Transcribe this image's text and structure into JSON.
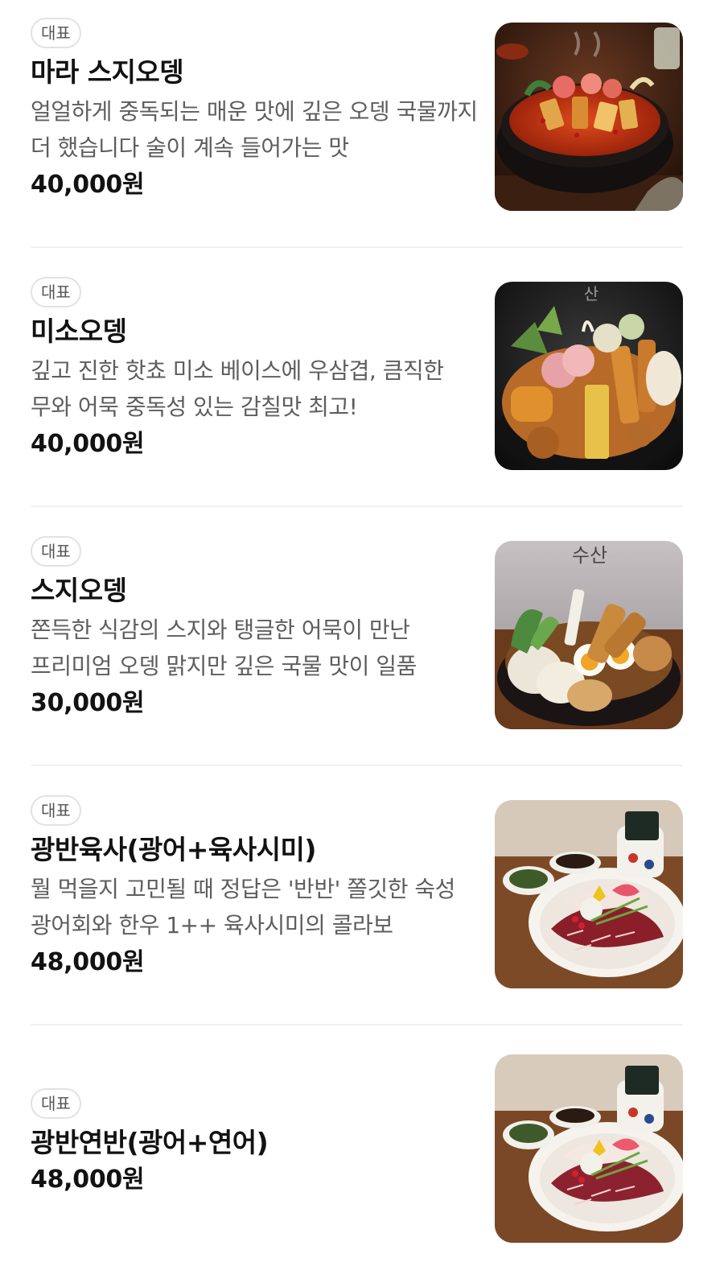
{
  "items": [
    {
      "badge": "대표",
      "name": "마라 스지오뎅",
      "description": "얼얼하게 중독되는 매운 맛에 깊은 오뎅 국물까지 더 했습니다 술이 계속 들어가는 맛",
      "price": "40,000원",
      "image": "mala-oden-hotpot-photo"
    },
    {
      "badge": "대표",
      "name": "미소오뎅",
      "description": "깊고 진한 핫쵸 미소 베이스에 우삼겹, 큼직한 무와 어묵 중독성 있는 감칠맛 최고!",
      "price": "40,000원",
      "image": "miso-oden-hotpot-photo",
      "image_text": "산"
    },
    {
      "badge": "대표",
      "name": "스지오뎅",
      "description": "쫀득한 식감의 스지와 탱글한 어묵이 만난 프리미엄 오뎅 맑지만 깊은 국물 맛이 일품",
      "price": "30,000원",
      "image": "suji-oden-hotpot-photo",
      "image_text": "수산"
    },
    {
      "badge": "대표",
      "name": "광반육사(광어+육사시미)",
      "description": "뭘 먹을지 고민될 때 정답은 '반반' 쫄깃한 숙성 광어회와 한우 1++ 육사시미의 콜라보",
      "price": "48,000원",
      "image": "flatfish-and-beef-sashimi-platter-photo"
    },
    {
      "badge": "대표",
      "name": "광반연반(광어+연어)",
      "description": "",
      "price": "48,000원",
      "image": "flatfish-and-salmon-platter-photo"
    }
  ],
  "colors": {
    "badge_border": "#e2e2e2",
    "name_text": "#121212",
    "desc_text": "#5e5e5e",
    "divider": "#f1f1f1"
  }
}
